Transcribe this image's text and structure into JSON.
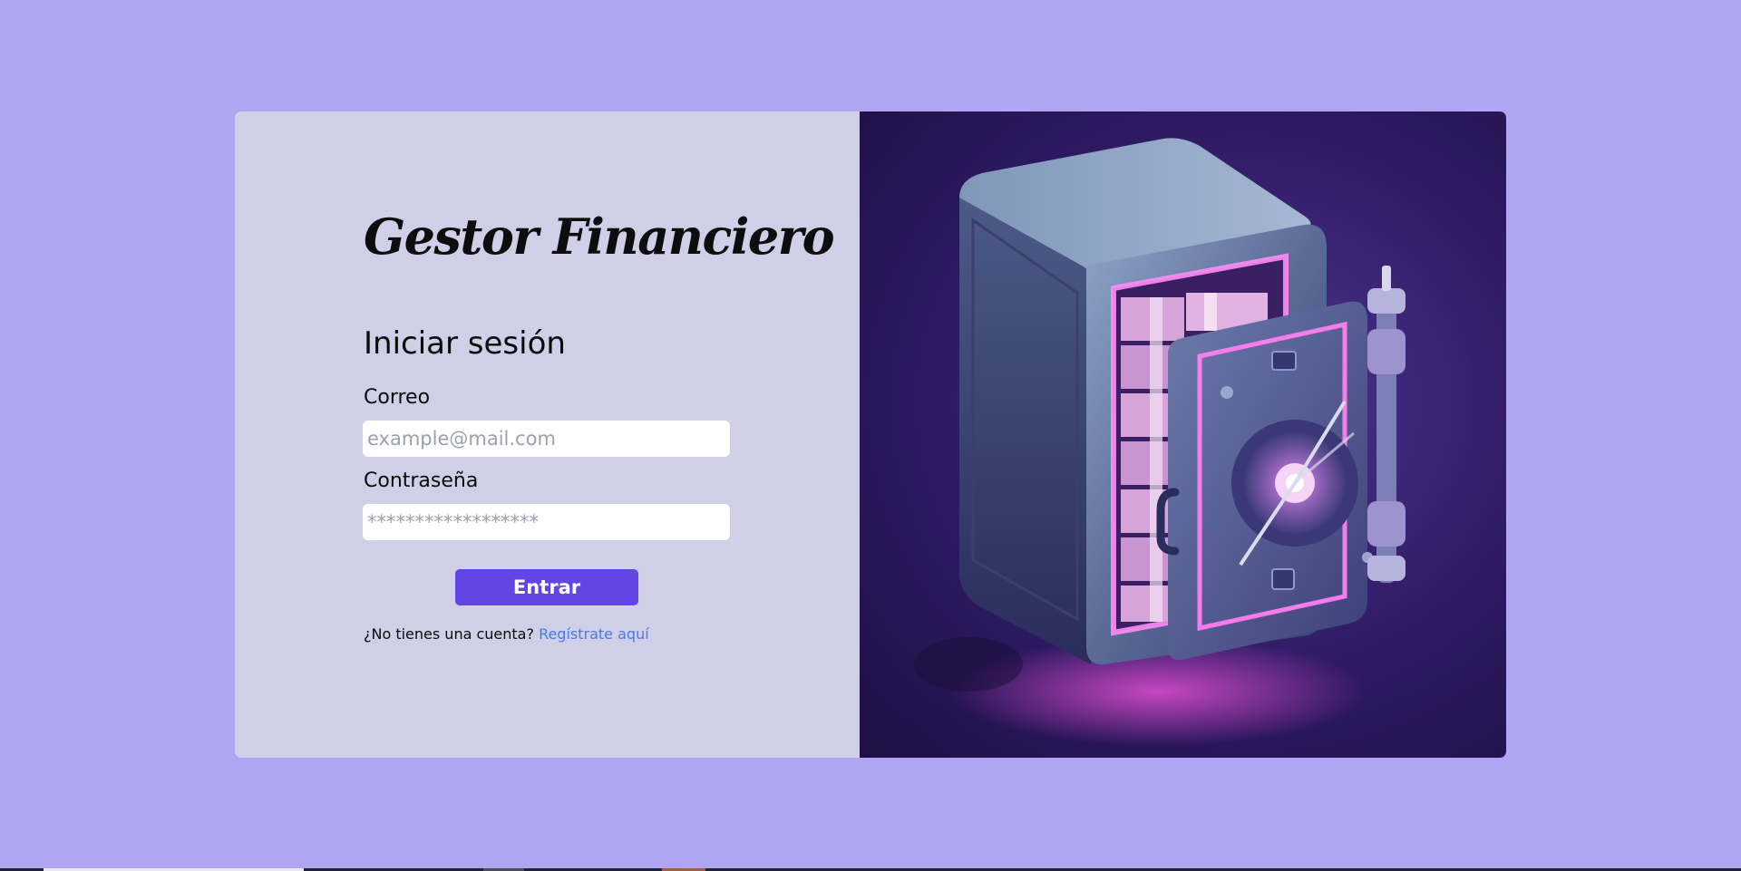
{
  "app": {
    "brand": "Gestor Financiero"
  },
  "login_form": {
    "title": "Iniciar sesión",
    "email_label": "Correo",
    "email_placeholder": "example@mail.com",
    "password_label": "Contraseña",
    "password_placeholder": "******************",
    "submit_label": "Entrar",
    "signup_prompt": "¿No tienes una cuenta?",
    "signup_link": "Regístrate aquí"
  },
  "illustration": {
    "icon": "safe-with-cash-icon"
  },
  "colors": {
    "background": "#b0a5f3",
    "panel": "#d0cfe8",
    "primary_button": "#6246e5",
    "link": "#4b7be0"
  }
}
